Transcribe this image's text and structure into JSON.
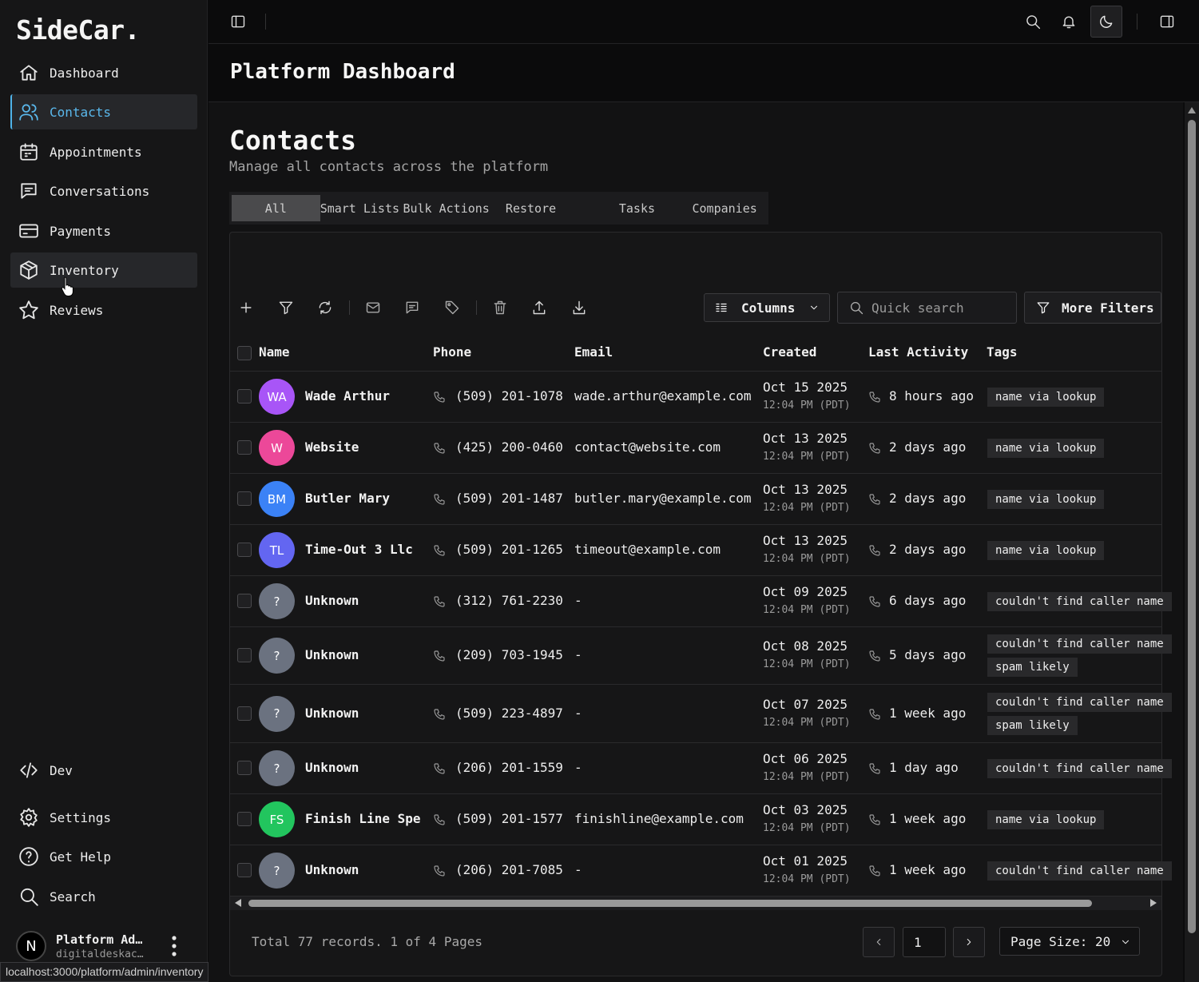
{
  "brand": "SideCar.",
  "sidebar": {
    "items": [
      {
        "label": "Dashboard",
        "icon": "home-icon"
      },
      {
        "label": "Contacts",
        "icon": "users-icon"
      },
      {
        "label": "Appointments",
        "icon": "calendar-icon"
      },
      {
        "label": "Conversations",
        "icon": "chat-icon"
      },
      {
        "label": "Payments",
        "icon": "credit-card-icon"
      },
      {
        "label": "Inventory",
        "icon": "package-icon"
      },
      {
        "label": "Reviews",
        "icon": "star-icon"
      }
    ],
    "bottom_items": [
      {
        "label": "Dev",
        "icon": "code-icon"
      },
      {
        "label": "Settings",
        "icon": "gear-icon"
      },
      {
        "label": "Get Help",
        "icon": "help-circle-icon"
      },
      {
        "label": "Search",
        "icon": "search-icon"
      }
    ],
    "user": {
      "initial": "N",
      "name": "Platform Ad…",
      "email": "digitaldeskac…"
    }
  },
  "status_url": "localhost:3000/platform/admin/inventory",
  "header": {
    "title": "Platform Dashboard"
  },
  "page": {
    "title": "Contacts",
    "subtitle": "Manage all contacts across the platform"
  },
  "tabs": [
    "All",
    "Smart Lists",
    "Bulk Actions",
    "Restore",
    "Tasks",
    "Companies"
  ],
  "toolbar": {
    "columns_label": "Columns",
    "search_placeholder": "Quick search",
    "filters_label": "More Filters"
  },
  "table": {
    "columns": [
      "Name",
      "Phone",
      "Email",
      "Created",
      "Last Activity",
      "Tags"
    ],
    "rows": [
      {
        "initials": "WA",
        "color": "#a855f7",
        "name": "Wade Arthur",
        "phone": "(509) 201-1078",
        "email": "wade.arthur@example.com",
        "date": "Oct 15 2025",
        "time": "12:04 PM (PDT)",
        "activity": "8 hours ago",
        "tags": [
          "name via lookup"
        ]
      },
      {
        "initials": "W",
        "color": "#ec4899",
        "name": "Website",
        "phone": "(425) 200-0460",
        "email": "contact@website.com",
        "date": "Oct 13 2025",
        "time": "12:04 PM (PDT)",
        "activity": "2 days ago",
        "tags": [
          "name via lookup"
        ]
      },
      {
        "initials": "BM",
        "color": "#3b82f6",
        "name": "Butler Mary",
        "phone": "(509) 201-1487",
        "email": "butler.mary@example.com",
        "date": "Oct 13 2025",
        "time": "12:04 PM (PDT)",
        "activity": "2 days ago",
        "tags": [
          "name via lookup"
        ]
      },
      {
        "initials": "TL",
        "color": "#6366f1",
        "name": "Time-Out 3 Llc",
        "phone": "(509) 201-1265",
        "email": "timeout@example.com",
        "date": "Oct 13 2025",
        "time": "12:04 PM (PDT)",
        "activity": "2 days ago",
        "tags": [
          "name via lookup"
        ]
      },
      {
        "initials": "?",
        "color": "#6b7280",
        "name": "Unknown",
        "phone": "(312) 761-2230",
        "email": "-",
        "date": "Oct 09 2025",
        "time": "12:04 PM (PDT)",
        "activity": "6 days ago",
        "tags": [
          "couldn't find caller name"
        ]
      },
      {
        "initials": "?",
        "color": "#6b7280",
        "name": "Unknown",
        "phone": "(209) 703-1945",
        "email": "-",
        "date": "Oct 08 2025",
        "time": "12:04 PM (PDT)",
        "activity": "5 days ago",
        "tags": [
          "couldn't find caller name",
          "spam likely"
        ]
      },
      {
        "initials": "?",
        "color": "#6b7280",
        "name": "Unknown",
        "phone": "(509) 223-4897",
        "email": "-",
        "date": "Oct 07 2025",
        "time": "12:04 PM (PDT)",
        "activity": "1 week ago",
        "tags": [
          "couldn't find caller name",
          "spam likely"
        ]
      },
      {
        "initials": "?",
        "color": "#6b7280",
        "name": "Unknown",
        "phone": "(206) 201-1559",
        "email": "-",
        "date": "Oct 06 2025",
        "time": "12:04 PM (PDT)",
        "activity": "1 day ago",
        "tags": [
          "couldn't find caller name"
        ]
      },
      {
        "initials": "FS",
        "color": "#22c55e",
        "name": "Finish Line Spe",
        "phone": "(509) 201-1577",
        "email": "finishline@example.com",
        "date": "Oct 03 2025",
        "time": "12:04 PM (PDT)",
        "activity": "1 week ago",
        "tags": [
          "name via lookup"
        ]
      },
      {
        "initials": "?",
        "color": "#6b7280",
        "name": "Unknown",
        "phone": "(206) 201-7085",
        "email": "-",
        "date": "Oct 01 2025",
        "time": "12:04 PM (PDT)",
        "activity": "1 week ago",
        "tags": [
          "couldn't find caller name"
        ]
      }
    ]
  },
  "footer": {
    "summary": "Total 77 records. 1 of 4 Pages",
    "current_page": "1",
    "page_size": "Page Size: 20"
  }
}
